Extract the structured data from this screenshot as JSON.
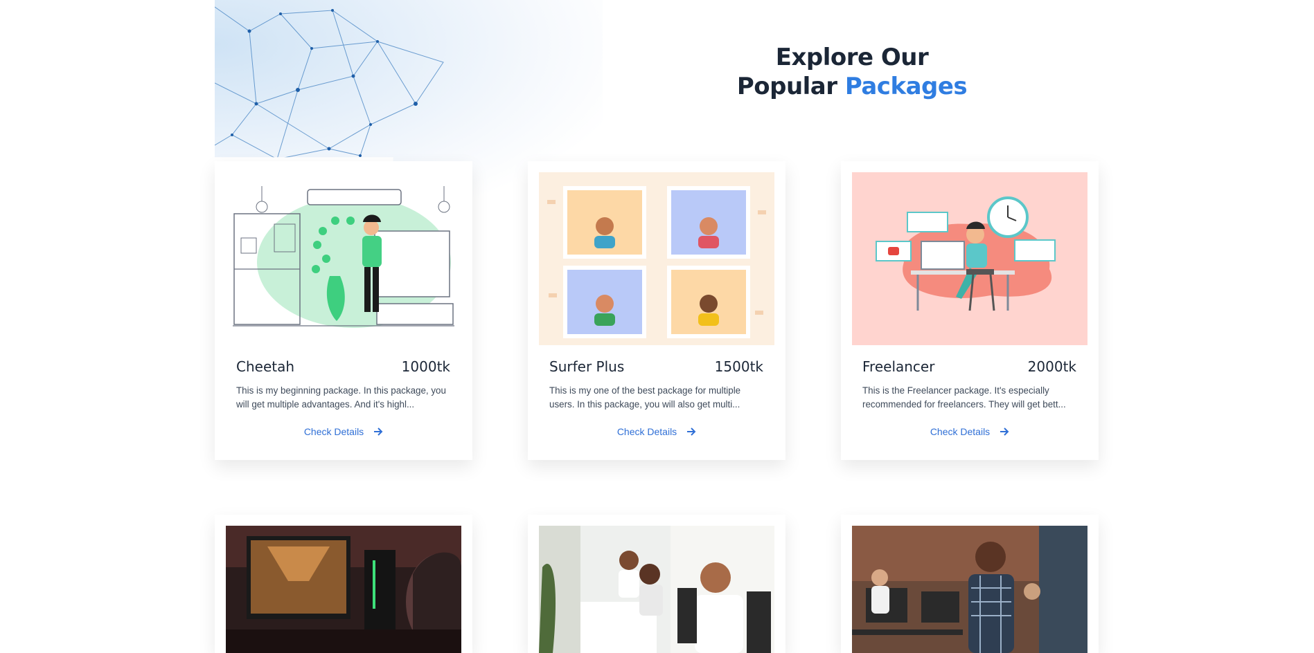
{
  "section": {
    "title_line1": "Explore Our",
    "title_line2_plain": "Popular ",
    "title_line2_accent": "Packages"
  },
  "colors": {
    "accent": "#2f7de1",
    "heading": "#1b2636",
    "link": "#2f6fd6"
  },
  "packages": [
    {
      "name": "Cheetah",
      "price": "1000tk",
      "description": "This is my beginning package. In this package, you will get multiple advantages. And it's highl...",
      "cta": "Check Details"
    },
    {
      "name": "Surfer Plus",
      "price": "1500tk",
      "description": "This is my one of the best package for multiple users. In this package, you will also get multi...",
      "cta": "Check Details"
    },
    {
      "name": "Freelancer",
      "price": "2000tk",
      "description": "This is the Freelancer package. It's especially recommended for freelancers. They will get bett...",
      "cta": "Check Details"
    }
  ],
  "icons": {
    "cta_arrow": "arrow-right-icon"
  }
}
